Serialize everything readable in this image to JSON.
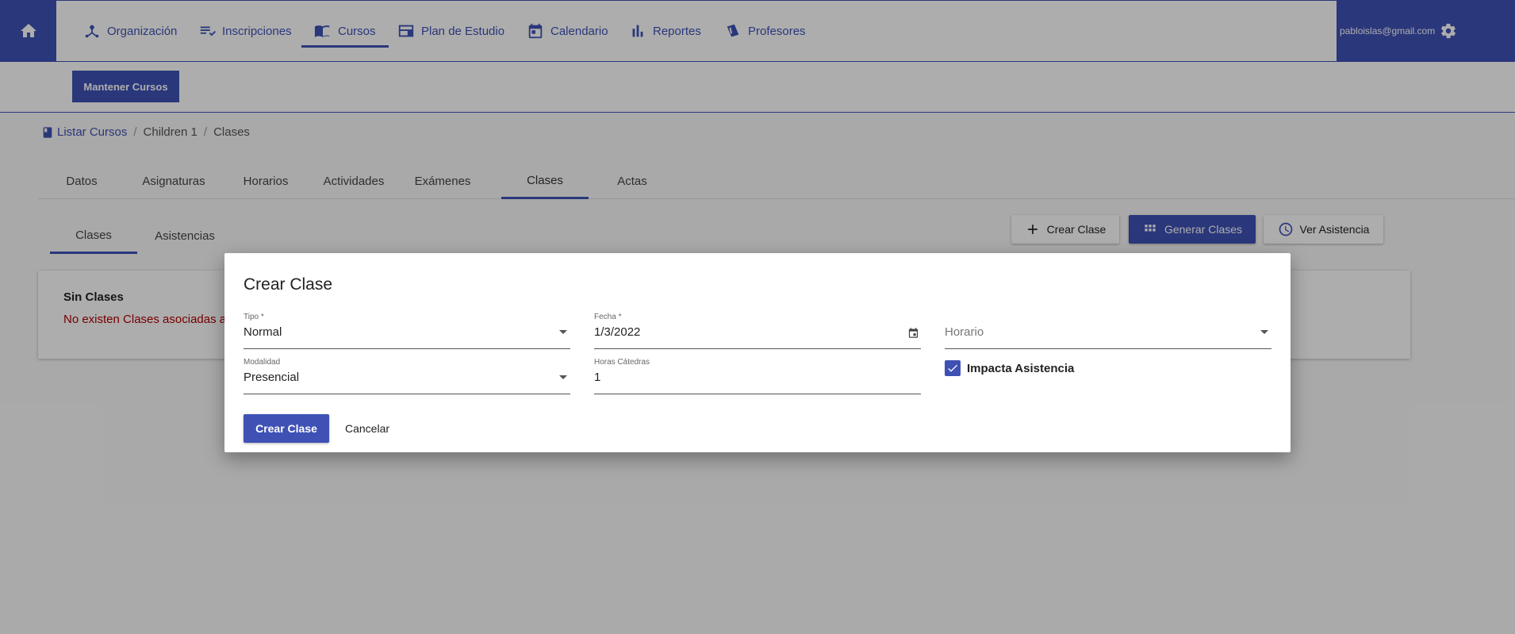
{
  "nav": {
    "items": [
      {
        "label": "Organización",
        "icon": "organization-icon"
      },
      {
        "label": "Inscripciones",
        "icon": "playlist-check-icon"
      },
      {
        "label": "Cursos",
        "icon": "book-icon"
      },
      {
        "label": "Plan de Estudio",
        "icon": "calendar-view-icon"
      },
      {
        "label": "Calendario",
        "icon": "calendar-icon"
      },
      {
        "label": "Reportes",
        "icon": "bar-chart-icon"
      },
      {
        "label": "Profesores",
        "icon": "teacher-icon"
      }
    ],
    "user_email": "pabloislas@gmail.com"
  },
  "subbar": {
    "mantener_label": "Mantener Cursos"
  },
  "breadcrumb": {
    "root": "Listar Cursos",
    "course": "Children 1",
    "current": "Clases"
  },
  "tabs": [
    "Datos",
    "Asignaturas",
    "Horarios",
    "Actividades",
    "Exámenes",
    "Clases",
    "Actas"
  ],
  "subtabs": [
    "Clases",
    "Asistencias"
  ],
  "actions": {
    "crear": "Crear Clase",
    "generar": "Generar Clases",
    "ver": "Ver Asistencia"
  },
  "empty": {
    "title": "Sin Clases",
    "message": "No existen Clases asociadas a e"
  },
  "dialog": {
    "title": "Crear Clase",
    "tipo_label": "Tipo *",
    "tipo_value": "Normal",
    "fecha_label": "Fecha *",
    "fecha_value": "1/3/2022",
    "horario_placeholder": "Horario",
    "modalidad_label": "Modalidad",
    "modalidad_value": "Presencial",
    "horas_label": "Horas Cátedras",
    "horas_value": "1",
    "impacta_label": "Impacta Asistencia",
    "impacta_checked": true,
    "submit_label": "Crear Clase",
    "cancel_label": "Cancelar"
  },
  "colors": {
    "primary": "#3f51b5",
    "error": "#b00000"
  }
}
